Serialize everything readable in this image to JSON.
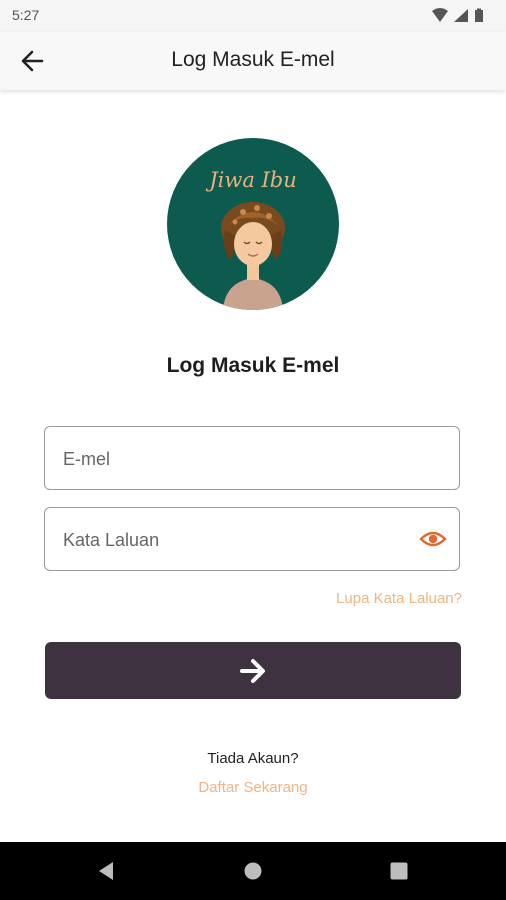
{
  "status_bar": {
    "time": "5:27",
    "icons": [
      "wifi-icon",
      "signal-icon",
      "battery-icon"
    ]
  },
  "app_bar": {
    "title": "Log Masuk E-mel",
    "back_icon": "arrow-left-icon"
  },
  "logo": {
    "text": "Jiwa Ibu",
    "background_color": "#0d5a4f",
    "text_color": "#e7b07f"
  },
  "form": {
    "heading": "Log Masuk E-mel",
    "email": {
      "placeholder": "E-mel",
      "value": ""
    },
    "password": {
      "placeholder": "Kata Laluan",
      "value": "",
      "toggle_icon": "eye-icon"
    },
    "forgot_password": "Lupa Kata Laluan?",
    "submit_icon": "arrow-right-icon",
    "submit_color": "#3e3240",
    "accent_color": "#f0b483"
  },
  "footer": {
    "no_account": "Tiada Akaun?",
    "register": "Daftar Sekarang"
  },
  "nav_bar": {
    "icons": [
      "nav-back-icon",
      "nav-home-icon",
      "nav-recents-icon"
    ]
  }
}
